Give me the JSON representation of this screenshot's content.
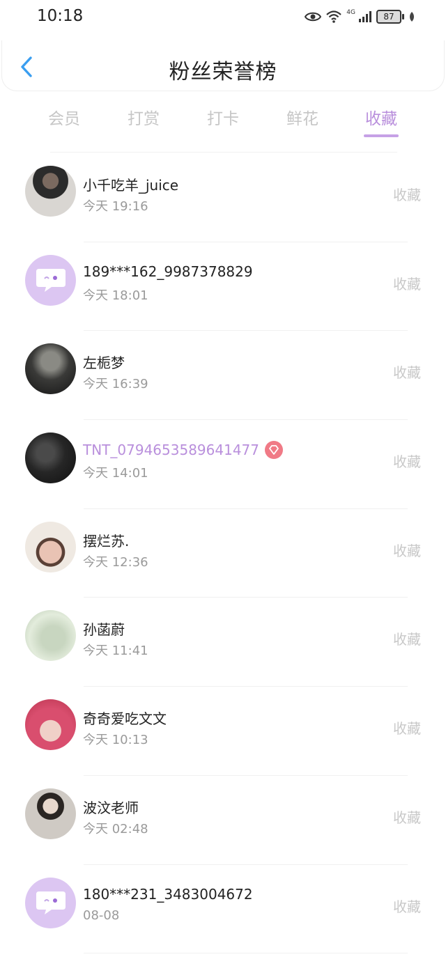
{
  "status": {
    "time": "10:18",
    "network": "4G",
    "battery": "87"
  },
  "header": {
    "title": "粉丝荣誉榜"
  },
  "tabs": [
    {
      "label": "会员",
      "active": false
    },
    {
      "label": "打赏",
      "active": false
    },
    {
      "label": "打卡",
      "active": false
    },
    {
      "label": "鲜花",
      "active": false
    },
    {
      "label": "收藏",
      "active": true
    }
  ],
  "colors": {
    "accent": "#b98fdc",
    "vip_badge": "#f07a86",
    "placeholder_avatar": "#dcc6f2"
  },
  "fans": [
    {
      "name": "小千吃羊_juice",
      "time": "今天 19:16",
      "action": "收藏",
      "vip": false,
      "avatar": "photo"
    },
    {
      "name": "189***162_9987378829",
      "time": "今天 18:01",
      "action": "收藏",
      "vip": false,
      "avatar": "default-chat-icon"
    },
    {
      "name": "左栀梦",
      "time": "今天 16:39",
      "action": "收藏",
      "vip": false,
      "avatar": "photo"
    },
    {
      "name": "TNT_0794653589641477",
      "time": "今天 14:01",
      "action": "收藏",
      "vip": true,
      "avatar": "photo"
    },
    {
      "name": "摆烂苏.",
      "time": "今天 12:36",
      "action": "收藏",
      "vip": false,
      "avatar": "photo"
    },
    {
      "name": "孙菡蔚",
      "time": "今天 11:41",
      "action": "收藏",
      "vip": false,
      "avatar": "photo"
    },
    {
      "name": "奇奇爱吃文文",
      "time": "今天 10:13",
      "action": "收藏",
      "vip": false,
      "avatar": "photo"
    },
    {
      "name": "波汶老师",
      "time": "今天 02:48",
      "action": "收藏",
      "vip": false,
      "avatar": "photo"
    },
    {
      "name": "180***231_3483004672",
      "time": "08-08",
      "action": "收藏",
      "vip": false,
      "avatar": "default-chat-icon"
    }
  ]
}
